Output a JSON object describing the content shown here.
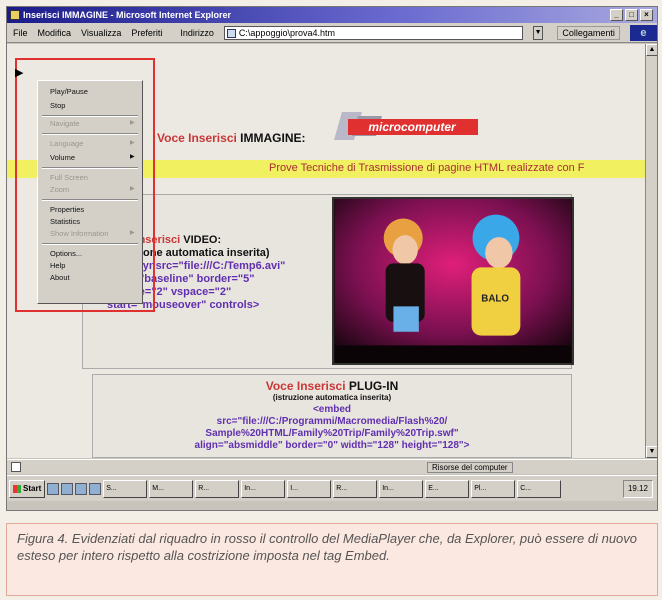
{
  "window": {
    "title": "Inserisci IMMAGINE - Microsoft Internet Explorer",
    "controls": [
      "_",
      "□",
      "×"
    ]
  },
  "menubar": {
    "items": [
      "File",
      "Modifica",
      "Visualizza",
      "Preferiti"
    ],
    "address_label": "Indirizzo",
    "address_value": "C:\\appoggio\\prova4.htm",
    "links_label": "Collegamenti"
  },
  "context_menu": {
    "play_icon": "play-triangle",
    "items": [
      {
        "label": "Play/Pause",
        "enabled": true,
        "submenu": false
      },
      {
        "label": "Stop",
        "enabled": true,
        "submenu": false
      },
      {
        "label": "Navigate",
        "enabled": false,
        "submenu": true
      },
      {
        "label": "Language",
        "enabled": false,
        "submenu": true
      },
      {
        "label": "Volume",
        "enabled": true,
        "submenu": true
      },
      {
        "label": "Full Screen",
        "enabled": false,
        "submenu": false
      },
      {
        "label": "Zoom",
        "enabled": false,
        "submenu": true
      },
      {
        "label": "Properties",
        "enabled": true,
        "submenu": false
      },
      {
        "label": "Statistics",
        "enabled": true,
        "submenu": false
      },
      {
        "label": "Show Information",
        "enabled": false,
        "submenu": true
      },
      {
        "label": "Options...",
        "enabled": true,
        "submenu": false
      },
      {
        "label": "Help",
        "enabled": true,
        "submenu": false
      },
      {
        "label": "About",
        "enabled": true,
        "submenu": false
      }
    ]
  },
  "page": {
    "img_heading_red": "Voce Inserisci",
    "img_heading_bold": "IMMAGINE:",
    "logo_text": "microcomputer",
    "banner": "Prove Tecniche di Trasmissione di pagine HTML realizzate con F",
    "video_heading_red": "Voce Inserisci",
    "video_heading_bold": "VIDEO:",
    "video_sub": "(istruzione automatica inserita)",
    "video_code": [
      "<img dynsrc=\"file:///C:/Temp6.avi\"",
      "align=\"baseline\" border=\"5\"",
      "hspace=\"2\" vspace=\"2\"",
      "start=\"mouseover\" controls>"
    ],
    "video_frame_label": "video-frame",
    "plugin_heading_red": "Voce Inserisci",
    "plugin_heading_bold": "PLUG-IN",
    "plugin_sub": "(istruzione automatica inserita)",
    "plugin_code": [
      "<embed",
      "src=\"file:///C:/Programmi/Macromedia/Flash%20/",
      "Sample%20HTML/Family%20Trip/Family%20Trip.swf\"",
      "align=\"absmiddle\" border=\"0\" width=\"128\" height=\"128\">"
    ]
  },
  "statusbar": {
    "zone": "Risorse del computer"
  },
  "taskbar": {
    "start_label": "Start",
    "buttons": [
      "S...",
      "M...",
      "R...",
      "In...",
      "I...",
      "R...",
      "In...",
      "E...",
      "Pl...",
      "C..."
    ],
    "clock": "19.12"
  },
  "caption": {
    "text": "Figura 4. Evidenziati dal riquadro in rosso il controllo del MediaPlayer che, da Explorer, può essere di nuovo esteso per intero rispetto alla costrizione imposta nel tag Embed."
  },
  "colors": {
    "highlight_box": "#e03030",
    "title_bar": "#1b1b8a",
    "banner_yellow": "#f0f060",
    "caption_bg": "#fbe8e0"
  }
}
